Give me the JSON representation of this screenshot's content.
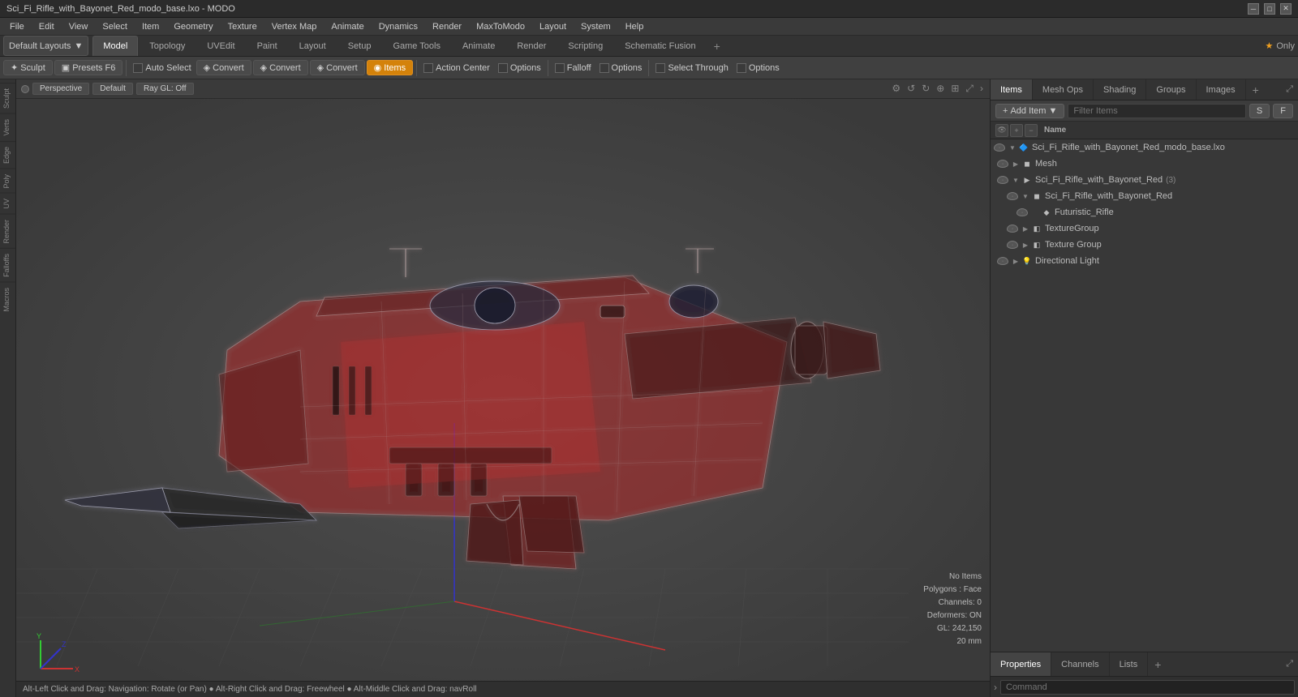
{
  "titleBar": {
    "title": "Sci_Fi_Rifle_with_Bayonet_Red_modo_base.lxo - MODO",
    "minimize": "─",
    "maximize": "□",
    "close": "✕"
  },
  "menuBar": {
    "items": [
      "File",
      "Edit",
      "View",
      "Select",
      "Item",
      "Geometry",
      "Texture",
      "Vertex Map",
      "Animate",
      "Dynamics",
      "Render",
      "MaxToModo",
      "Layout",
      "System",
      "Help"
    ]
  },
  "layoutTabs": {
    "defaultLayouts": "Default Layouts",
    "tabs": [
      "Model",
      "Topology",
      "UVEdit",
      "Paint",
      "Layout",
      "Setup",
      "Game Tools",
      "Animate",
      "Render",
      "Scripting",
      "Schematic Fusion"
    ],
    "activeTab": "Model",
    "addBtn": "+",
    "starLabel": "★ Only"
  },
  "toolbar": {
    "sculpt": "Sculpt",
    "presets": "Presets",
    "presetsShortcut": "F6",
    "autoSelect": "Auto Select",
    "convert1": "Convert",
    "convert2": "Convert",
    "convert3": "Convert",
    "items": "Items",
    "actionCenter": "Action Center",
    "options1": "Options",
    "falloff": "Falloff",
    "options2": "Options",
    "selectThrough": "Select Through",
    "options3": "Options"
  },
  "viewport": {
    "perspective": "Perspective",
    "default": "Default",
    "rayGL": "Ray GL: Off"
  },
  "statusBar": {
    "text": "Alt-Left Click and Drag: Navigation: Rotate (or Pan) ● Alt-Right Click and Drag: Freewheel ● Alt-Middle Click and Drag: navRoll"
  },
  "viewportStatus": {
    "noItems": "No Items",
    "polygons": "Polygons : Face",
    "channels": "Channels: 0",
    "deformers": "Deformers: ON",
    "gl": "GL: 242,150",
    "size": "20 mm"
  },
  "rightPanel": {
    "tabs": [
      "Items",
      "Mesh Ops",
      "Shading",
      "Groups",
      "Images"
    ],
    "addBtn": "+",
    "addItemBtn": "Add Item",
    "filterPlaceholder": "Filter Items",
    "filterBtnS": "S",
    "filterBtnF": "F",
    "colName": "Name",
    "tree": [
      {
        "id": 1,
        "indent": 0,
        "arrow": "▼",
        "icon": "scene",
        "label": "Sci_Fi_Rifle_with_Bayonet_Red_modo_base.lxo",
        "eye": true
      },
      {
        "id": 2,
        "indent": 1,
        "arrow": "▶",
        "icon": "mesh",
        "label": "Mesh",
        "eye": true
      },
      {
        "id": 3,
        "indent": 1,
        "arrow": "▼",
        "icon": "group",
        "label": "Sci_Fi_Rifle_with_Bayonet_Red",
        "badge": "(3)",
        "eye": true
      },
      {
        "id": 4,
        "indent": 2,
        "arrow": "▼",
        "icon": "mesh",
        "label": "Sci_Fi_Rifle_with_Bayonet_Red",
        "eye": true
      },
      {
        "id": 5,
        "indent": 3,
        "arrow": "",
        "icon": "item",
        "label": "Futuristic_Rifle",
        "eye": true
      },
      {
        "id": 6,
        "indent": 2,
        "arrow": "▶",
        "icon": "texgroup",
        "label": "TextureGroup",
        "eye": true
      },
      {
        "id": 7,
        "indent": 2,
        "arrow": "▶",
        "icon": "texgroup",
        "label": "Texture Group",
        "eye": true
      },
      {
        "id": 8,
        "indent": 1,
        "arrow": "▶",
        "icon": "light",
        "label": "Directional Light",
        "eye": true
      }
    ]
  },
  "bottomPanel": {
    "tabs": [
      "Properties",
      "Channels",
      "Lists"
    ],
    "activeTab": "Properties",
    "addBtn": "+",
    "commandPlaceholder": "Command"
  }
}
